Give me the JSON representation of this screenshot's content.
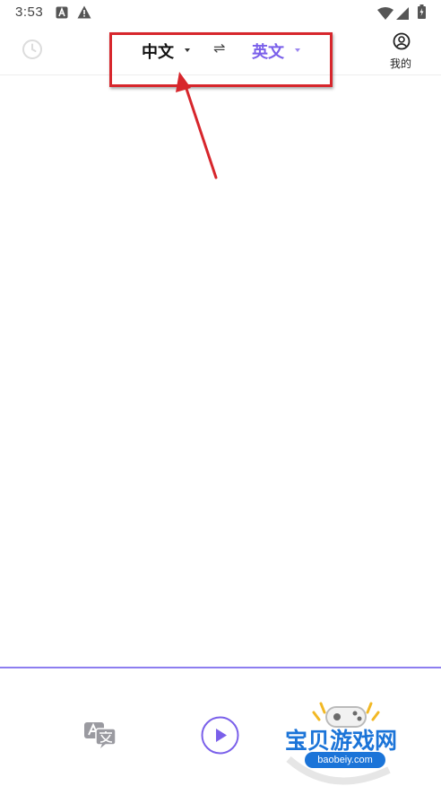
{
  "status_bar": {
    "time": "3:53",
    "icons": [
      "notification-a-icon",
      "warning-icon",
      "wifi-icon",
      "signal-icon",
      "battery-icon"
    ]
  },
  "header": {
    "history_icon": "clock-icon",
    "source_language": "中文",
    "swap_icon": "⇌",
    "target_language": "英文",
    "me_icon": "user-circle-icon",
    "me_label": "我的"
  },
  "bottom": {
    "translate_icon": "translate-icon",
    "play_icon": "play-icon"
  },
  "watermark": {
    "brand": "宝贝游戏网",
    "url": "baobeiy.com"
  },
  "colors": {
    "accent": "#7a60ea",
    "divider": "#8d7ef0",
    "annotation": "#d7262c",
    "watermark": "#1b74d8"
  }
}
